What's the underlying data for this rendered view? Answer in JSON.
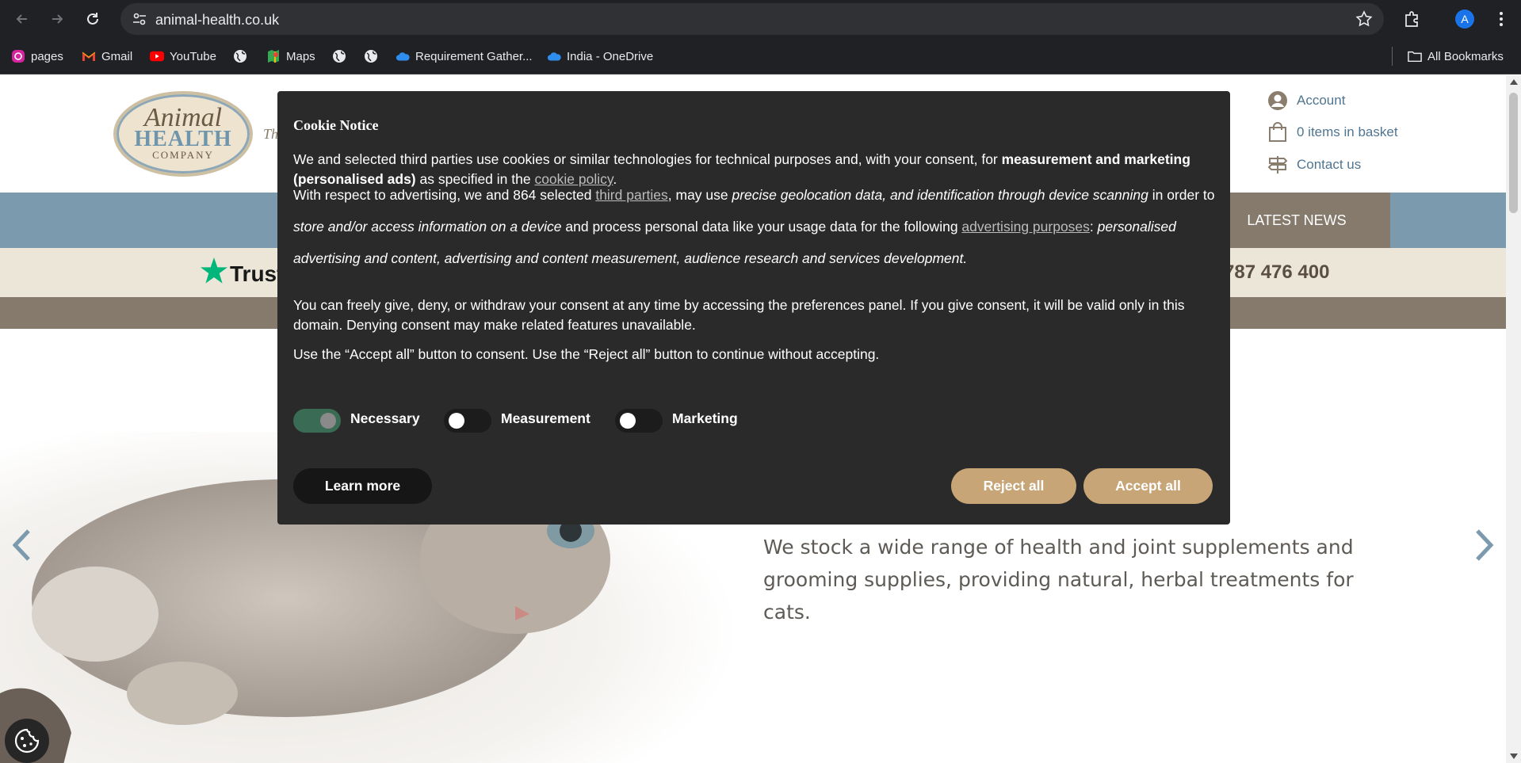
{
  "browser": {
    "url": "animal-health.co.uk",
    "bookmarks": [
      {
        "label": "pages",
        "icon": "instagram-icon"
      },
      {
        "label": "Gmail",
        "icon": "gmail-icon"
      },
      {
        "label": "YouTube",
        "icon": "youtube-icon"
      },
      {
        "label": "",
        "icon": "globe-icon"
      },
      {
        "label": "Maps",
        "icon": "maps-icon"
      },
      {
        "label": "",
        "icon": "globe-icon"
      },
      {
        "label": "",
        "icon": "globe-icon"
      },
      {
        "label": "Requirement Gather...",
        "icon": "onedrive-icon"
      },
      {
        "label": "India - OneDrive",
        "icon": "onedrive-icon"
      }
    ],
    "all_bookmarks": "All Bookmarks",
    "profile_initial": "A"
  },
  "site": {
    "logo": {
      "line1": "Animal",
      "line2": "HEALTH",
      "line3": "COMPANY"
    },
    "tagline": "Th",
    "header_links": {
      "account": "Account",
      "basket": "0 items in basket",
      "contact": "Contact us"
    },
    "nav": {
      "latest_news": "LATEST NEWS"
    },
    "trust_word": "Trust",
    "phone": "787 476 400",
    "hero_text": "We stock a wide range of health and joint supplements and grooming supplies, providing natural, herbal treatments for cats."
  },
  "cookie": {
    "title": "Cookie Notice",
    "p1_a": "We and selected third parties use cookies or similar technologies for technical purposes and, with your consent, for ",
    "p1_bold": "measurement and marketing (personalised ads)",
    "p1_b": " as specified in the ",
    "p1_link": "cookie policy",
    "p1_c": ".",
    "p2_a": "With respect to advertising, we and 864 selected ",
    "p2_link1": "third parties",
    "p2_b": ", may use ",
    "p2_em1": "precise geolocation data, and identification through device scanning",
    "p2_c": " in order to ",
    "p2_em2": "store and/or access information on a device",
    "p2_d": " and process personal data like your usage data for the following ",
    "p2_link2": "advertising purposes",
    "p2_e": ": ",
    "p2_em3": "personalised advertising and content, advertising and content measurement, audience research and services development.",
    "p3": "You can freely give, deny, or withdraw your consent at any time by accessing the preferences panel. If you give consent, it will be valid only in this domain. Denying consent may make related features unavailable.",
    "p4": "Use the “Accept all” button to consent. Use the “Reject all” button to continue without accepting.",
    "toggles": {
      "necessary": {
        "label": "Necessary",
        "on": true
      },
      "measurement": {
        "label": "Measurement",
        "on": false
      },
      "marketing": {
        "label": "Marketing",
        "on": false
      }
    },
    "learn_more": "Learn more",
    "reject_all": "Reject all",
    "accept_all": "Accept all",
    "accent_color": "#c7a577"
  }
}
